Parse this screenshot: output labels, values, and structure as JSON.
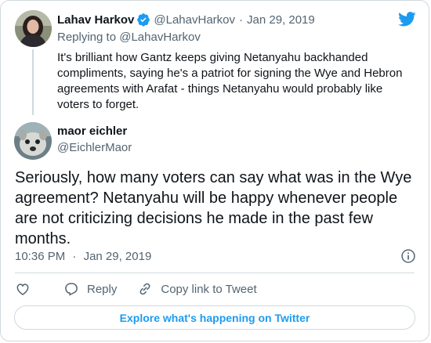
{
  "colors": {
    "accent": "#1d9bf0",
    "muted": "#536471",
    "text": "#0f1419",
    "border": "#cfd9de"
  },
  "parent": {
    "name": "Lahav Harkov",
    "handle": "@LahavHarkov",
    "separator": "·",
    "date": "Jan 29, 2019",
    "replying_prefix": "Replying to",
    "replying_to": "@LahavHarkov",
    "text": "It's brilliant how Gantz keeps giving Netanyahu backhanded compliments, saying he's a patriot for signing the Wye and Hebron agreements with Arafat - things Netanyahu would probably like voters to forget."
  },
  "tweet": {
    "name": "maor eichler",
    "handle": "@EichlerMaor",
    "text": "Seriously, how many voters can say what was in the Wye agreement? Netanyahu will be happy whenever people are not criticizing decisions he made in the past few months.",
    "time": "10:36 PM",
    "separator": "·",
    "date": "Jan 29, 2019"
  },
  "actions": {
    "reply_label": "Reply",
    "copy_label": "Copy link to Tweet"
  },
  "explore_label": "Explore what's happening on Twitter",
  "icons": [
    "twitter-bird-icon",
    "verified-badge-icon",
    "info-icon",
    "heart-icon",
    "reply-icon",
    "link-icon"
  ]
}
